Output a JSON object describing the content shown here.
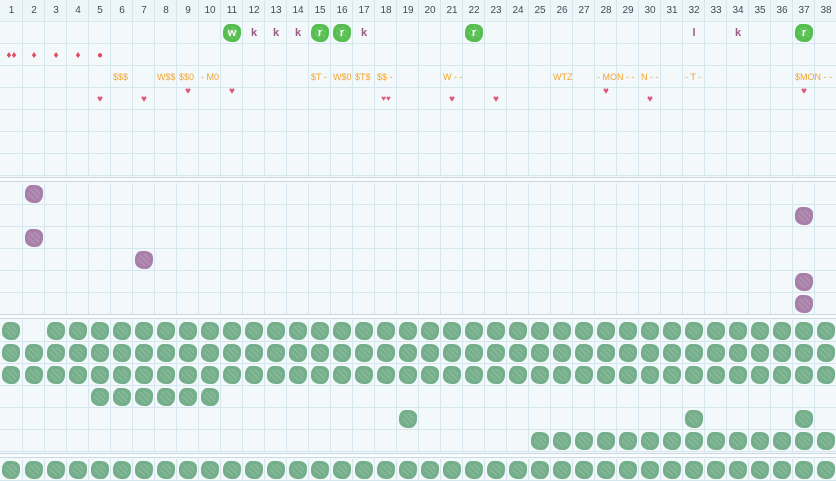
{
  "columns": [
    "1",
    "2",
    "3",
    "4",
    "5",
    "6",
    "7",
    "8",
    "9",
    "10",
    "11",
    "12",
    "13",
    "14",
    "15",
    "16",
    "17",
    "18",
    "19",
    "20",
    "21",
    "22",
    "23",
    "24",
    "25",
    "26",
    "27",
    "28",
    "29",
    "30",
    "31",
    "32",
    "33",
    "34",
    "35",
    "36",
    "37",
    "38"
  ],
  "colors": {
    "grid": "#d6e6ee",
    "green_blob": "#74ae8a",
    "purple_blob": "#a77fa9",
    "bright_green": "#56bd4f",
    "orange_text": "#f2a52e",
    "red": "#e24b5e",
    "pink": "#dc5a79"
  },
  "annotation_rows": {
    "row1": [
      {
        "col": 11,
        "kind": "bright",
        "text": "w"
      },
      {
        "col": 12,
        "kind": "letter",
        "text": "k"
      },
      {
        "col": 13,
        "kind": "letter",
        "text": "k"
      },
      {
        "col": 14,
        "kind": "letter",
        "text": "k"
      },
      {
        "col": 15,
        "kind": "bright",
        "text": "r"
      },
      {
        "col": 16,
        "kind": "bright",
        "text": "r"
      },
      {
        "col": 17,
        "kind": "letter",
        "text": "k"
      },
      {
        "col": 22,
        "kind": "bright",
        "text": "r"
      },
      {
        "col": 32,
        "kind": "letter",
        "text": "l"
      },
      {
        "col": 34,
        "kind": "letter",
        "text": "k"
      },
      {
        "col": 37,
        "kind": "bright",
        "text": "r"
      }
    ],
    "row2": [
      {
        "col": 1,
        "kind": "red",
        "text": "♦♦"
      },
      {
        "col": 2,
        "kind": "red",
        "text": "♦"
      },
      {
        "col": 3,
        "kind": "red",
        "text": "♦"
      },
      {
        "col": 4,
        "kind": "red",
        "text": "♦"
      },
      {
        "col": 5,
        "kind": "red",
        "text": "●"
      }
    ],
    "row3": [
      {
        "col": 6,
        "kind": "orange",
        "text": "$$$"
      },
      {
        "col": 8,
        "kind": "orange",
        "text": "W$$"
      },
      {
        "col": 9,
        "kind": "orange",
        "text": "$$0"
      },
      {
        "col": 10,
        "kind": "orange",
        "text": "- M0"
      },
      {
        "col": 15,
        "kind": "orange",
        "text": "$T -"
      },
      {
        "col": 16,
        "kind": "orange",
        "text": "W$0"
      },
      {
        "col": 17,
        "kind": "orange",
        "text": "$T$"
      },
      {
        "col": 18,
        "kind": "orange",
        "text": "$$ -"
      },
      {
        "col": 21,
        "kind": "orange",
        "text": "W - -"
      },
      {
        "col": 26,
        "kind": "orange",
        "text": "WTZ"
      },
      {
        "col": 28,
        "kind": "orange",
        "text": "- MON - -"
      },
      {
        "col": 30,
        "kind": "orange",
        "text": "N - -"
      },
      {
        "col": 32,
        "kind": "orange",
        "text": "- T -"
      },
      {
        "col": 37,
        "kind": "orange",
        "text": "$MON - -"
      }
    ],
    "row4": [
      {
        "col": 5,
        "kind": "pink",
        "text": "♥"
      },
      {
        "col": 7,
        "kind": "pink",
        "text": "♥"
      },
      {
        "col": 9,
        "kind": "pink",
        "text": "♥",
        "up": true
      },
      {
        "col": 11,
        "kind": "pink",
        "text": "♥",
        "up": true
      },
      {
        "col": 18,
        "kind": "pink",
        "text": "♥♥"
      },
      {
        "col": 21,
        "kind": "pink",
        "text": "♥"
      },
      {
        "col": 23,
        "kind": "pink",
        "text": "♥"
      },
      {
        "col": 28,
        "kind": "pink",
        "text": "♥",
        "up": true
      },
      {
        "col": 30,
        "kind": "pink",
        "text": "♥"
      },
      {
        "col": 37,
        "kind": "pink",
        "text": "♥",
        "up": true
      }
    ]
  },
  "purple_cells": [
    [
      2,
      1
    ],
    [
      37,
      2
    ],
    [
      2,
      3
    ],
    [
      7,
      4
    ],
    [
      37,
      5
    ],
    [
      37,
      6
    ]
  ],
  "green_rows": {
    "full": [
      1,
      2,
      3,
      8
    ],
    "row1_skip": [
      2
    ],
    "row4_cols": [
      5,
      6,
      7,
      8,
      9,
      10
    ],
    "row5_cols": [
      19,
      32,
      37
    ],
    "row6_from": 25
  }
}
